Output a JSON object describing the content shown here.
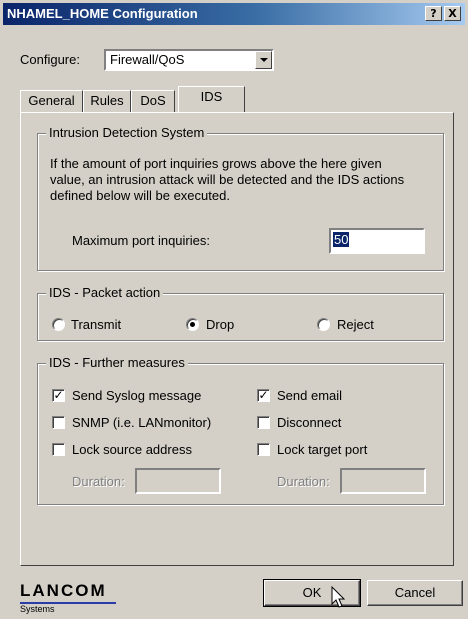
{
  "window": {
    "title": "NHAMEL_HOME Configuration"
  },
  "titlebar_buttons": {
    "help": "?",
    "close": "X"
  },
  "configure": {
    "label": "Configure:",
    "value": "Firewall/QoS"
  },
  "tabs": [
    {
      "label": "General",
      "active": false
    },
    {
      "label": "Rules",
      "active": false
    },
    {
      "label": "DoS",
      "active": false
    },
    {
      "label": "IDS",
      "active": true
    }
  ],
  "ids": {
    "title": "Intrusion Detection System",
    "description_lines": [
      "If the amount of port inquiries grows above the here given",
      "value, an intrusion attack will be detected and the IDS actions",
      "defined below will be executed."
    ],
    "max_label": "Maximum port inquiries:",
    "max_value": "50"
  },
  "packet_action": {
    "title": "IDS - Packet action",
    "options": [
      {
        "label": "Transmit",
        "selected": false
      },
      {
        "label": "Drop",
        "selected": true
      },
      {
        "label": "Reject",
        "selected": false
      }
    ]
  },
  "measures": {
    "title": "IDS - Further measures",
    "send_syslog": {
      "label": "Send Syslog message",
      "checked": true
    },
    "send_email": {
      "label": "Send email",
      "checked": true
    },
    "snmp": {
      "label": "SNMP (i.e. LANmonitor)",
      "checked": false
    },
    "disconnect": {
      "label": "Disconnect",
      "checked": false
    },
    "lock_source": {
      "label": "Lock source address",
      "checked": false
    },
    "lock_target": {
      "label": "Lock target port",
      "checked": false
    },
    "duration_label": "Duration:",
    "duration_source_value": "",
    "duration_target_value": ""
  },
  "buttons": {
    "ok": "OK",
    "cancel": "Cancel"
  },
  "logo": {
    "brand": "LANCOM",
    "sub": "Systems"
  }
}
